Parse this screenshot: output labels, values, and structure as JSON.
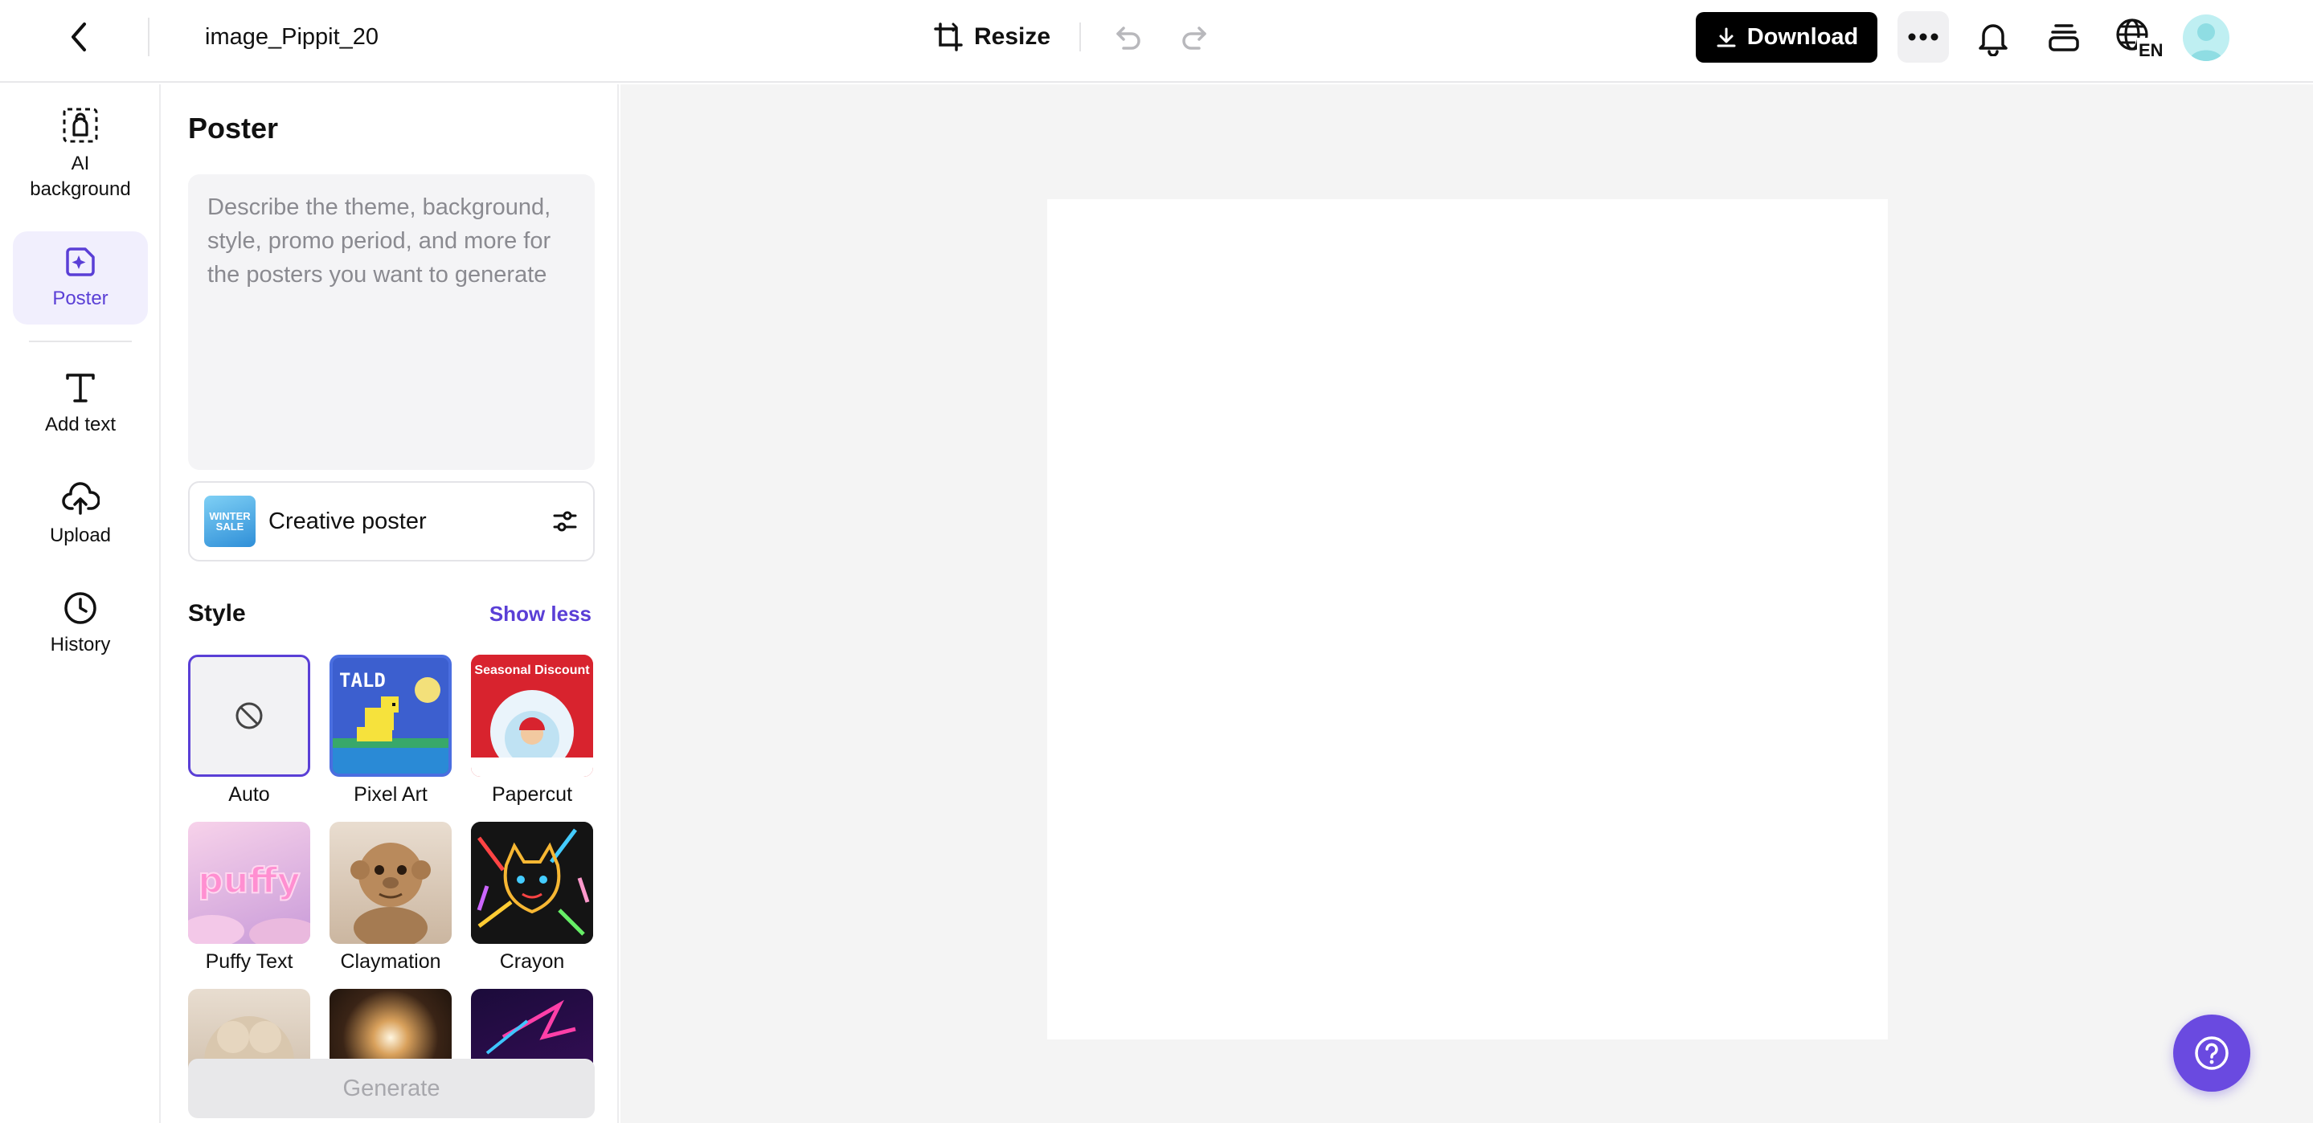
{
  "header": {
    "doc_title": "image_Pippit_20",
    "resize_label": "Resize",
    "download_label": "Download",
    "lang_code": "EN"
  },
  "rail": {
    "items": [
      {
        "label": "AI background",
        "icon": "ai-background-icon"
      },
      {
        "label": "Poster",
        "icon": "poster-icon",
        "active": true
      },
      {
        "label": "Add text",
        "icon": "text-icon"
      },
      {
        "label": "Upload",
        "icon": "upload-cloud-icon"
      },
      {
        "label": "History",
        "icon": "clock-icon"
      }
    ]
  },
  "panel": {
    "title": "Poster",
    "prompt_placeholder": "Describe the theme, background, style, promo period, and more for the posters you want to generate",
    "poster_type": {
      "label": "Creative poster",
      "thumb_text": "WINTER SALE"
    },
    "style_heading": "Style",
    "show_less_label": "Show less",
    "styles": [
      {
        "label": "Auto",
        "selected": true
      },
      {
        "label": "Pixel Art",
        "thumb_text": "TALD"
      },
      {
        "label": "Papercut",
        "thumb_text": "Seasonal Discount"
      },
      {
        "label": "Puffy Text",
        "thumb_text": "puffy"
      },
      {
        "label": "Claymation"
      },
      {
        "label": "Crayon"
      },
      {
        "label": ""
      },
      {
        "label": ""
      },
      {
        "label": ""
      }
    ],
    "generate_label": "Generate"
  },
  "colors": {
    "accent": "#5a3fd6",
    "help_button": "#6a4ae0",
    "canvas_bg": "#f4f4f4"
  }
}
